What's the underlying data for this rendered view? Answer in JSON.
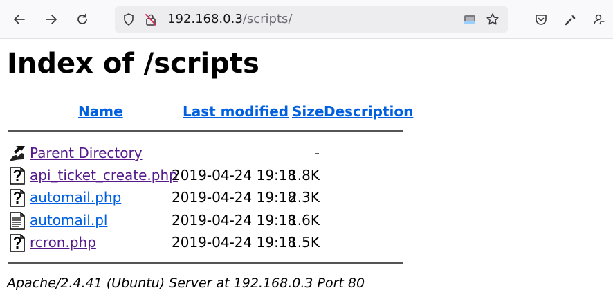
{
  "browser": {
    "url_host": "192.168.0.3",
    "url_path": "/scripts/",
    "icons": [
      "back-arrow-icon",
      "forward-arrow-icon",
      "reload-icon",
      "shield-icon",
      "insecure-lock-icon",
      "reader-view-icon",
      "bookmark-star-icon",
      "pocket-icon",
      "tools-wrench-icon",
      "account-icon"
    ]
  },
  "page": {
    "title": "Index of /scripts",
    "columns": {
      "name": "Name",
      "last_modified": "Last modified",
      "size": "Size",
      "description": "Description"
    },
    "rows": [
      {
        "name": "Parent Directory",
        "date": "",
        "size": "-",
        "icon": "parent-directory-icon",
        "visited": true
      },
      {
        "name": "api_ticket_create.php",
        "date": "2019-04-24 19:18",
        "size": "1.8K",
        "icon": "unknown-file-icon",
        "visited": true
      },
      {
        "name": "automail.php",
        "date": "2019-04-24 19:18",
        "size": "2.3K",
        "icon": "unknown-file-icon",
        "visited": false
      },
      {
        "name": "automail.pl",
        "date": "2019-04-24 19:18",
        "size": "1.6K",
        "icon": "text-file-icon",
        "visited": false
      },
      {
        "name": "rcron.php",
        "date": "2019-04-24 19:18",
        "size": "1.5K",
        "icon": "unknown-file-icon",
        "visited": true
      }
    ],
    "footer": "Apache/2.4.41 (Ubuntu) Server at 192.168.0.3 Port 80"
  },
  "colors": {
    "link": "#0060df",
    "visited": "#551a8b",
    "toolbar_bg": "#f9f9fb",
    "urlbar_bg": "#ededf0"
  }
}
